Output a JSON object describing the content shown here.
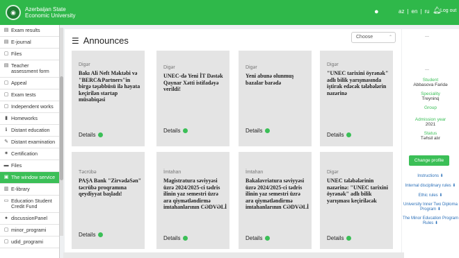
{
  "header": {
    "logo_text": "",
    "university_line1": "Azerbaijan State",
    "university_line2": "Economic University",
    "lang_az": "az",
    "lang_en": "en",
    "lang_ru": "ru",
    "logout": "Log out",
    "accent": "#2fb84a"
  },
  "sidebar": {
    "items": [
      {
        "icon": "list-icon",
        "glyph": "▤",
        "label": "Exam results"
      },
      {
        "icon": "journal-icon",
        "glyph": "▤",
        "label": "E-journal"
      },
      {
        "icon": "file-icon",
        "glyph": "▢",
        "label": "Files"
      },
      {
        "icon": "table-icon",
        "glyph": "▤",
        "label": "Teacher assessment form"
      },
      {
        "icon": "file-icon",
        "glyph": "▢",
        "label": "Appeal"
      },
      {
        "icon": "file-icon",
        "glyph": "▢",
        "label": "Exam tests"
      },
      {
        "icon": "file-icon",
        "glyph": "▢",
        "label": "Independent works"
      },
      {
        "icon": "bookmark-icon",
        "glyph": "▮",
        "label": "Homeworks"
      },
      {
        "icon": "info-icon",
        "glyph": "ℹ",
        "label": "Distant education"
      },
      {
        "icon": "pencil-icon",
        "glyph": "✎",
        "label": "Distant examination"
      },
      {
        "icon": "certificate-icon",
        "glyph": "✷",
        "label": "Certification"
      },
      {
        "icon": "folder-icon",
        "glyph": "▬",
        "label": "Files"
      },
      {
        "icon": "window-icon",
        "glyph": "▣",
        "label": "The window service",
        "active": true
      },
      {
        "icon": "library-icon",
        "glyph": "▥",
        "label": "E-library"
      },
      {
        "icon": "credit-icon",
        "glyph": "▭",
        "label": "Education Student Credit Fund"
      },
      {
        "icon": "chat-icon",
        "glyph": "●",
        "label": "discussionPanel"
      },
      {
        "icon": "file-icon",
        "glyph": "▢",
        "label": "minor_programi"
      },
      {
        "icon": "file-icon",
        "glyph": "▢",
        "label": "udid_programi"
      }
    ]
  },
  "main": {
    "title": "Announces",
    "select_value": "Choose",
    "details_label": "Details",
    "cards": [
      {
        "category": "Digər",
        "title": "Bakı Ali Neft Məktəbi və \"BERC&Partners\"in birgə təşəbbüsü ilə həyata keçirilən startap müsabiqəsi"
      },
      {
        "category": "Digər",
        "title": "UNEC-də Yeni İT Dəstək Qaynar Xətti istifadəyə verildi!"
      },
      {
        "category": "Digər",
        "title": "Yeni abunə olunmuş bazalar barədə"
      },
      {
        "category": "Digər",
        "title": "\"UNEC tarixini öyrənək\" adlı bilik yarışmasında iştirak edəcək tələbələrin nəzərinə"
      },
      {
        "category": "Təcrübə",
        "title": "PAŞA Bank \"ZirvədəSən\" təcrübə proqramına qeydiyyat başladı!"
      },
      {
        "category": "İmtahan",
        "title": "Magistratura səviyyəsi üzrə 2024/2025-ci tədris ilinin yaz semestri üzrə ara qiymətləndirmə imtahanlarının CƏDVƏLİ"
      },
      {
        "category": "İmtahan",
        "title": "Bakalavriatura səviyyəsi üzrə 2024/2025-ci tədris ilinin yaz semestri üzrə ara qiymətləndirmə imtahanlarının CƏDVƏLİ"
      },
      {
        "category": "Digər",
        "title": "UNEC tələbələrinin nəzərinə: \"UNEC tarixini öyrənək\" adlı bilik yarışması keçiriləcək"
      }
    ]
  },
  "profile": {
    "student_label": "Student",
    "student_name": "Abbasova Faridə",
    "speciality_label": "Speciality",
    "speciality_value": "Treyninq",
    "group_label": "Group",
    "admission_label": "Admission year",
    "admission_value": "2021",
    "status_label": "Status",
    "status_value": "Təhsil alır",
    "change_button": "Change profile",
    "links": [
      "Instructions",
      "Internal disciplinary rules",
      "Ethic rules",
      "University Inner Two Diploma Program",
      "The Minor Education Program Rules"
    ]
  }
}
